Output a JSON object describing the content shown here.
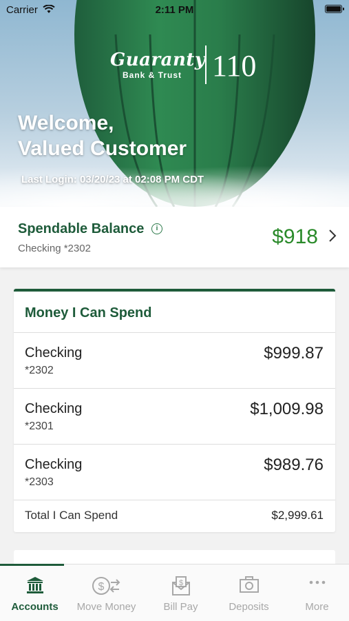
{
  "status_bar": {
    "carrier": "Carrier",
    "time": "2:11 PM"
  },
  "hero": {
    "logo_brand": "Guaranty",
    "logo_sub": "Bank & Trust",
    "logo_number": "110",
    "welcome_line1": "Welcome,",
    "welcome_line2": "Valued Customer",
    "last_login": "Last Login: 03/20/23 at 02:08 PM CDT"
  },
  "spendable": {
    "title": "Spendable Balance",
    "account": "Checking *2302",
    "amount": "$918"
  },
  "money_card": {
    "heading": "Money I Can Spend",
    "accounts": [
      {
        "name": "Checking",
        "number": "*2302",
        "balance": "$999.87"
      },
      {
        "name": "Checking",
        "number": "*2301",
        "balance": "$1,009.98"
      },
      {
        "name": "Checking",
        "number": "*2303",
        "balance": "$989.76"
      }
    ],
    "total_label": "Total I Can Spend",
    "total_value": "$2,999.61"
  },
  "tabs": [
    {
      "label": "Accounts",
      "icon": "bank-icon",
      "active": true
    },
    {
      "label": "Move Money",
      "icon": "transfer-icon",
      "active": false
    },
    {
      "label": "Bill Pay",
      "icon": "bill-envelope-icon",
      "active": false
    },
    {
      "label": "Deposits",
      "icon": "camera-icon",
      "active": false
    },
    {
      "label": "More",
      "icon": "more-dots-icon",
      "active": false
    }
  ],
  "colors": {
    "brand_green": "#1e5b3a",
    "amount_green": "#2a8a2a"
  }
}
